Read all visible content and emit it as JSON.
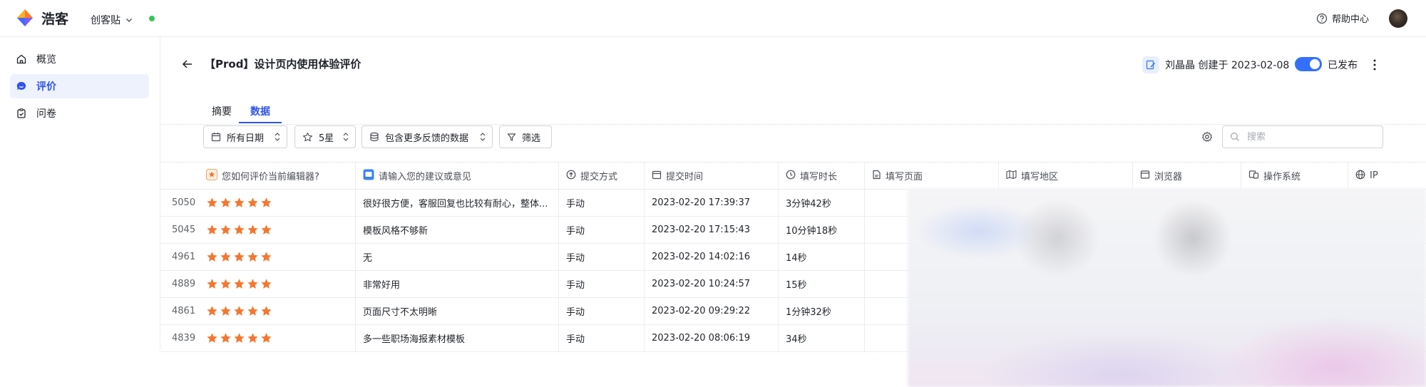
{
  "app": {
    "brand": "浩客",
    "workspace": "创客贴",
    "help": "帮助中心"
  },
  "sidebar": {
    "items": [
      {
        "label": "概览",
        "icon": "home-icon"
      },
      {
        "label": "评价",
        "icon": "chat-icon",
        "active": true
      },
      {
        "label": "问卷",
        "icon": "clipboard-icon"
      }
    ]
  },
  "header": {
    "title": "【Prod】设计页内使用体验评价",
    "creator": "刘晶晶 创建于 2023-02-08",
    "status": "已发布"
  },
  "tabs": [
    {
      "label": "摘要"
    },
    {
      "label": "数据",
      "active": true
    }
  ],
  "filters": {
    "date": "所有日期",
    "rating": "5星",
    "feedback": "包含更多反馈的数据",
    "filter_btn": "筛选",
    "search_placeholder": "搜索"
  },
  "table": {
    "columns": [
      {
        "label": "您如何评价当前编辑器?",
        "icon": "star-icon"
      },
      {
        "label": "请输入您的建议或意见",
        "icon": "comment-icon"
      },
      {
        "label": "提交方式",
        "icon": "upload-icon"
      },
      {
        "label": "提交时间",
        "icon": "calendar-icon"
      },
      {
        "label": "填写时长",
        "icon": "clock-icon"
      },
      {
        "label": "填写页面",
        "icon": "page-icon"
      },
      {
        "label": "填写地区",
        "icon": "map-icon"
      },
      {
        "label": "浏览器",
        "icon": "browser-icon"
      },
      {
        "label": "操作系统",
        "icon": "os-icon"
      },
      {
        "label": "IP",
        "icon": "globe-icon"
      }
    ],
    "rows": [
      {
        "id": "5050",
        "stars": 5,
        "comment": "很好很方便，客服回复也比较有耐心，整体...",
        "method": "手动",
        "time": "2023-02-20 17:39:37",
        "duration": "3分钟42秒"
      },
      {
        "id": "5045",
        "stars": 5,
        "comment": "模板风格不够新",
        "method": "手动",
        "time": "2023-02-20 17:15:43",
        "duration": "10分钟18秒"
      },
      {
        "id": "4961",
        "stars": 5,
        "comment": "无",
        "method": "手动",
        "time": "2023-02-20 14:02:16",
        "duration": "14秒"
      },
      {
        "id": "4889",
        "stars": 5,
        "comment": "非常好用",
        "method": "手动",
        "time": "2023-02-20 10:24:57",
        "duration": "15秒"
      },
      {
        "id": "4861",
        "stars": 5,
        "comment": "页面尺寸不太明晰",
        "method": "手动",
        "time": "2023-02-20 09:29:22",
        "duration": "1分钟32秒"
      },
      {
        "id": "4839",
        "stars": 5,
        "comment": "多一些职场海报素材模板",
        "method": "手动",
        "time": "2023-02-20 08:06:19",
        "duration": "34秒"
      }
    ]
  },
  "colors": {
    "accent": "#2f54eb",
    "star": "#f5772f",
    "toggle": "#3370ff",
    "online": "#34c759"
  }
}
